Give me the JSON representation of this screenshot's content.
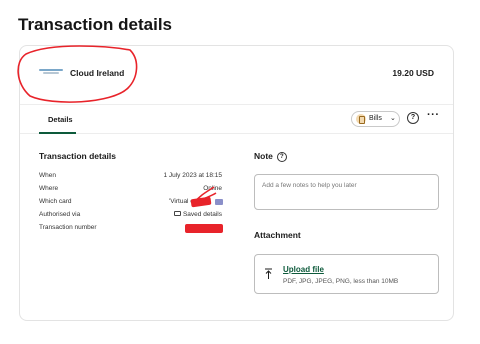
{
  "page": {
    "title": "Transaction details"
  },
  "merchant": {
    "name": "Cloud Ireland",
    "amount": "19.20 USD",
    "logo_icon": "merchant-logo"
  },
  "tabs": [
    {
      "label": "Details",
      "active": true
    }
  ],
  "category": {
    "label": "Bills",
    "icon": "bills-icon"
  },
  "actions": {
    "help_glyph": "?",
    "more_glyph": "···"
  },
  "details": {
    "title": "Transaction details",
    "rows": [
      {
        "label": "When",
        "value": "1 July 2023 at 18:15"
      },
      {
        "label": "Where",
        "value": "Online"
      },
      {
        "label": "Which card",
        "value": "'Virtual card',"
      },
      {
        "label": "Authorised via",
        "value": "Saved details"
      },
      {
        "label": "Transaction number",
        "value": "#"
      }
    ]
  },
  "note": {
    "title": "Note",
    "placeholder": "Add a few notes to help you later"
  },
  "attachment": {
    "title": "Attachment",
    "upload_label": "Upload file",
    "upload_hint": "PDF, JPG, JPEG, PNG, less than 10MB"
  },
  "colors": {
    "accent": "#0d5a3b",
    "annotation_red": "#e8232a",
    "border": "#e3e3e3"
  }
}
